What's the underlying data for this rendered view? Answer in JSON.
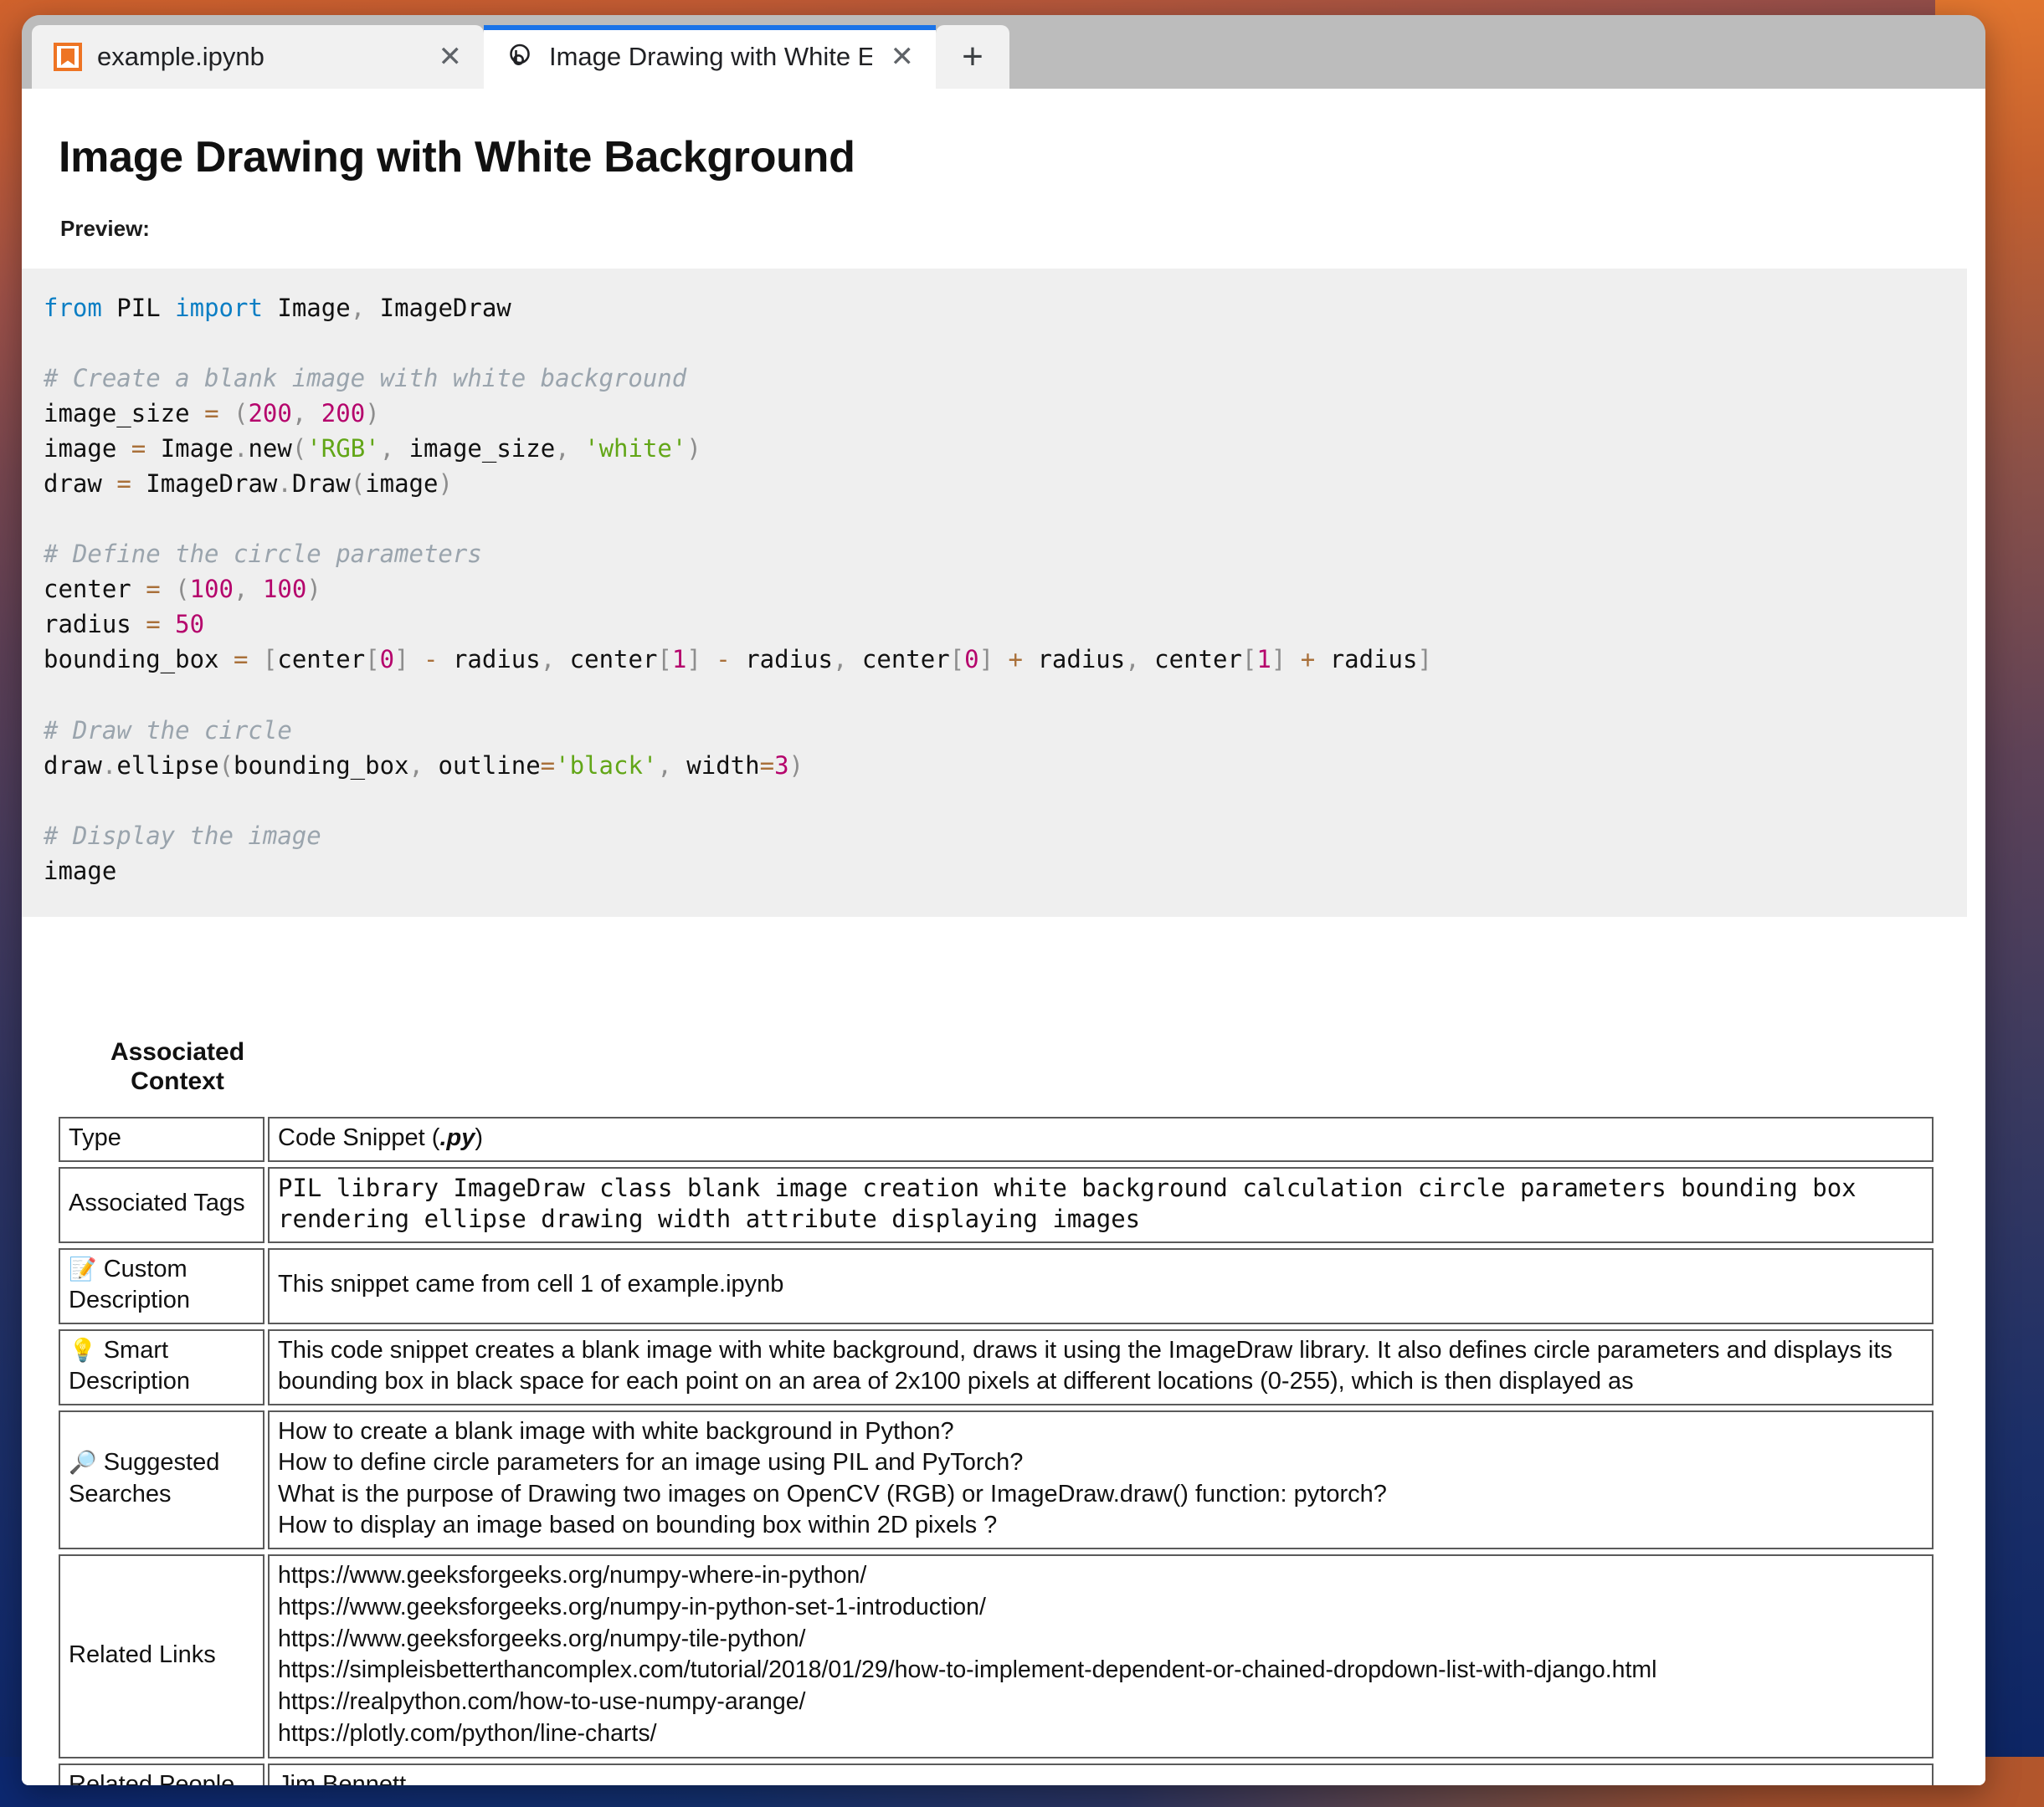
{
  "browser": {
    "tabs": [
      {
        "title": "example.ipynb",
        "icon": "jupyter-notebook-icon",
        "active": false,
        "close_label": "✕"
      },
      {
        "title": "Image Drawing with White E",
        "icon": "jupyter-logo-icon",
        "active": true,
        "close_label": "✕"
      }
    ],
    "new_tab_label": "+"
  },
  "page": {
    "title": "Image Drawing with White Background",
    "preview_label": "Preview:",
    "code": {
      "language": "python",
      "lines": [
        "from PIL import Image, ImageDraw",
        "",
        "# Create a blank image with white background",
        "image_size = (200, 200)",
        "image = Image.new('RGB', image_size, 'white')",
        "draw = ImageDraw.Draw(image)",
        "",
        "# Define the circle parameters",
        "center = (100, 100)",
        "radius = 50",
        "bounding_box = [center[0] - radius, center[1] - radius, center[0] + radius, center[1] + radius]",
        "",
        "# Draw the circle",
        "draw.ellipse(bounding_box, outline='black', width=3)",
        "",
        "# Display the image",
        "image"
      ]
    }
  },
  "context": {
    "heading_line1": "Associated",
    "heading_line2": "Context",
    "rows": [
      {
        "label": "Type",
        "label_icon": "",
        "value": "Code Snippet ( .py )",
        "value_prefix": "Code Snippet (",
        "value_emph": ".py",
        "value_suffix": ")"
      },
      {
        "label": "Associated Tags",
        "label_icon": "",
        "value": "PIL library ImageDraw class blank image creation white background calculation circle parameters bounding box rendering ellipse drawing width attribute displaying images",
        "tags": [
          "PIL",
          "library",
          "ImageDraw",
          "class",
          "blank",
          "image",
          "creation",
          "white",
          "background",
          "calculation",
          "circle",
          "parameters",
          "bounding",
          "box",
          "rendering",
          "ellipse",
          "drawing",
          "width",
          "attribute",
          "displaying",
          "images"
        ]
      },
      {
        "label": "Custom Description",
        "label_icon": "📝",
        "label_icon_name": "memo-icon",
        "value": "This snippet came from cell 1 of example.ipynb"
      },
      {
        "label": "Smart Description",
        "label_icon": "💡",
        "label_icon_name": "lightbulb-icon",
        "value": "This code snippet creates a blank image with white background, draws it using the ImageDraw library. It also defines circle parameters and displays its bounding box in black space for each point on an area of 2x100 pixels at different locations (0-255), which is then displayed as"
      },
      {
        "label": "Suggested Searches",
        "label_icon": "🔎",
        "label_icon_name": "magnifying-glass-icon",
        "items": [
          "How to create a blank image with white background in Python?",
          "How to define circle parameters for an image using PIL and PyTorch?",
          "What is the purpose of Drawing two images on OpenCV (RGB) or ImageDraw.draw() function: pytorch?",
          "How to display an image based on bounding box within 2D pixels ?"
        ]
      },
      {
        "label": "Related Links",
        "label_icon": "",
        "items": [
          "https://www.geeksforgeeks.org/numpy-where-in-python/",
          "https://www.geeksforgeeks.org/numpy-in-python-set-1-introduction/",
          "https://www.geeksforgeeks.org/numpy-tile-python/",
          "https://simpleisbetterthancomplex.com/tutorial/2018/01/29/how-to-implement-dependent-or-chained-dropdown-list-with-django.html",
          "https://realpython.com/how-to-use-numpy-arange/",
          "https://plotly.com/python/line-charts/"
        ]
      },
      {
        "label": "Related People",
        "label_icon": "",
        "value": "Jim Bennett"
      }
    ]
  },
  "colors": {
    "accent_tab": "#1a73e8",
    "jupyter_orange": "#ee7424",
    "code_bg": "#efefef",
    "keyword": "#0b7ec4",
    "comment": "#9aa4ad",
    "number": "#b5046c",
    "string": "#62a617",
    "operator": "#a9703a"
  }
}
